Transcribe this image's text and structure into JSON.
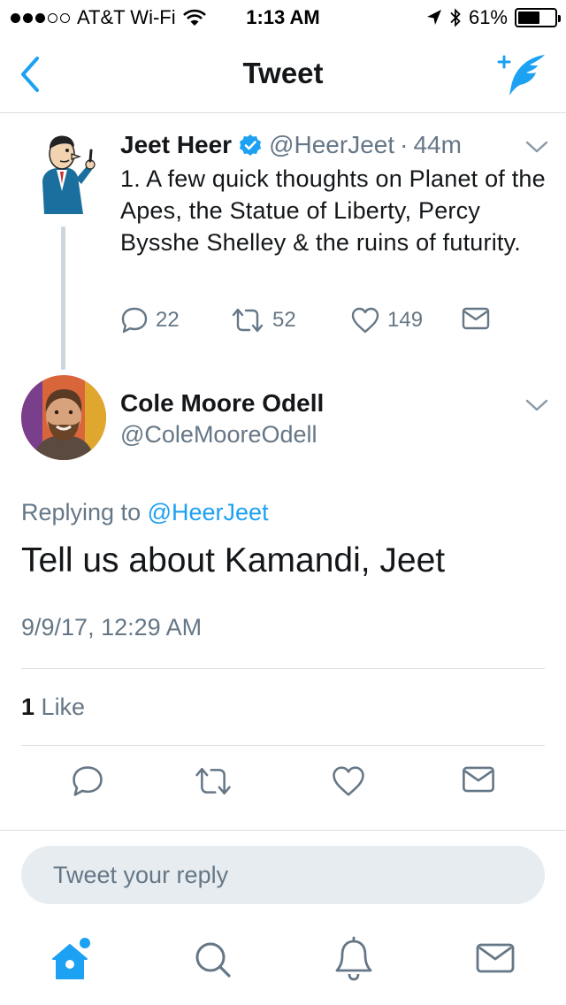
{
  "status_bar": {
    "carrier": "AT&T Wi-Fi",
    "time": "1:13 AM",
    "battery": "61%",
    "battery_level": 0.61,
    "signal_bars_filled": 3,
    "signal_bars_total": 5
  },
  "nav": {
    "title": "Tweet",
    "back_icon": "chevron-left-icon",
    "compose_icon": "compose-tweet-icon"
  },
  "parent_tweet": {
    "name": "Jeet Heer",
    "verified": true,
    "handle": "@HeerJeet",
    "separator": "·",
    "time": "44m",
    "text": "1. A few quick thoughts on Planet of the Apes, the Statue of Liberty, Percy Bysshe Shelley & the ruins of futurity.",
    "replies": "22",
    "retweets": "52",
    "likes": "149"
  },
  "tweet": {
    "name": "Cole Moore Odell",
    "handle": "@ColeMooreOdell",
    "replying_prefix": "Replying to",
    "replying_to": "@HeerJeet",
    "text": "Tell us about Kamandi, Jeet",
    "date": "9/9/17, 12:29 AM",
    "like_count": "1",
    "like_label": "Like"
  },
  "reply": {
    "placeholder": "Tweet your reply"
  },
  "tab_bar": {
    "tabs": [
      "home-icon",
      "search-icon",
      "notifications-icon",
      "messages-icon"
    ]
  },
  "colors": {
    "accent": "#1da1f2",
    "secondary_text": "#657786",
    "divider": "#d8dde1"
  }
}
